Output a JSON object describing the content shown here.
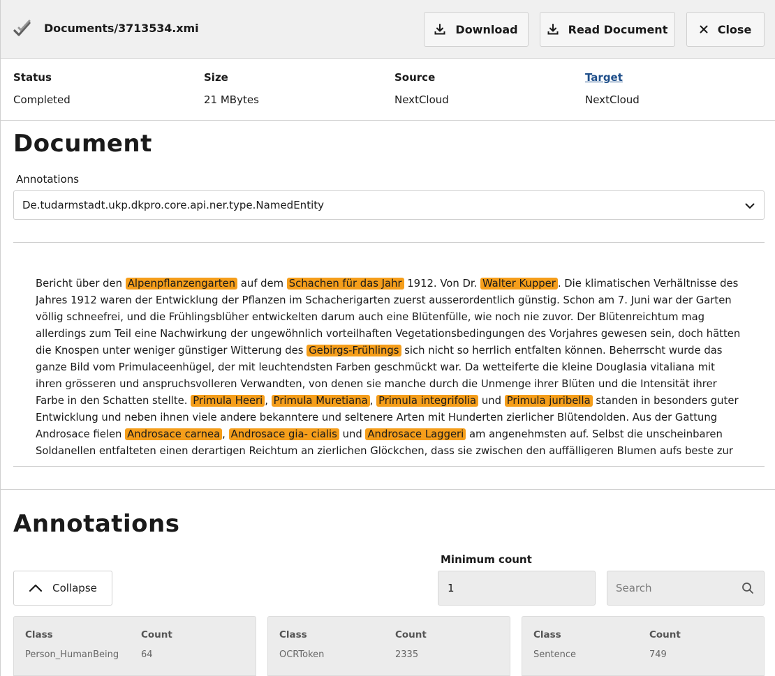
{
  "header": {
    "title": "Documents/3713534.xmi",
    "download_label": "Download",
    "read_label": "Read Document",
    "close_label": "Close"
  },
  "info": {
    "status": {
      "label": "Status",
      "value": "Completed"
    },
    "size": {
      "label": "Size",
      "value": "21 MBytes"
    },
    "source": {
      "label": "Source",
      "value": "NextCloud"
    },
    "target": {
      "label": "Target",
      "value": "NextCloud"
    }
  },
  "document": {
    "heading": "Document",
    "annotations_label": "Annotations",
    "annotation_type": "De.tudarmstadt.ukp.dkpro.core.api.ner.type.NamedEntity",
    "text_segments": [
      {
        "t": "Bericht über den "
      },
      {
        "t": "Alpenpflanzengarten",
        "e": true
      },
      {
        "t": " auf dem "
      },
      {
        "t": "Schachen für das Jahr",
        "e": true
      },
      {
        "t": " 1912. Von Dr. "
      },
      {
        "t": "Walter Kupper",
        "e": true
      },
      {
        "t": ". Die klimatischen Verhältnisse des Jahres 1912 waren der Entwicklung der Pflanzen im Schacherigarten zuerst ausserordentlich günstig. Schon am 7. Juni war der Garten völlig schneefrei, und die Frühlingsblüher entwickelten darum auch eine Blütenfülle, wie noch nie zuvor. Der Blütenreichtum mag allerdings zum Teil eine Nachwirkung der ungewöhnlich vorteilhaften Vegetationsbedingungen des Vorjahres gewesen sein, doch hätten die Knospen unter weniger günstiger Witterung des "
      },
      {
        "t": "Gebirgs-Frühlings",
        "e": true
      },
      {
        "t": " sich nicht so herrlich entfalten können. Beherrscht wurde das ganze Bild vom Primulaceenhügel, der mit leuchtendsten Farben geschmückt war. Da wetteiferte die kleine Douglasia vitaliana mit ihren grösseren und anspruchsvolleren Verwandten, von denen sie manche durch die Unmenge ihrer Blüten und die Intensität ihrer Farbe in den Schatten stellte. "
      },
      {
        "t": "Primula Heeri",
        "e": true
      },
      {
        "t": ", "
      },
      {
        "t": "Primula Muretiana",
        "e": true
      },
      {
        "t": ", "
      },
      {
        "t": "Primula integrifolia",
        "e": true
      },
      {
        "t": " und "
      },
      {
        "t": "Primula juribella",
        "e": true
      },
      {
        "t": " standen in besonders guter Entwicklung und neben ihnen viele andere bekanntere und seltenere Arten mit Hunderten zierlicher Blütendolden. Aus der Gattung Androsace fielen "
      },
      {
        "t": "Androsace carnea",
        "e": true
      },
      {
        "t": ", "
      },
      {
        "t": "Androsace gia- cialis",
        "e": true
      },
      {
        "t": " und "
      },
      {
        "t": "Androsace Laggeri",
        "e": true
      },
      {
        "t": " am angenehmsten auf. Selbst die unscheinbaren Soldanellen entfalteten einen derartigen Reichtum an zierlichen Glöckchen, dass sie zwischen den auffälligeren Blumen aufs beste zur"
      }
    ]
  },
  "annotations": {
    "heading": "Annotations",
    "collapse_label": "Collapse",
    "min_count_label": "Minimum count",
    "min_count_value": "1",
    "search_placeholder": "Search",
    "class_header": "Class",
    "count_header": "Count",
    "cards": [
      {
        "class": "Person_HumanBeing",
        "count": "64"
      },
      {
        "class": "OCRToken",
        "count": "2335"
      },
      {
        "class": "Sentence",
        "count": "749"
      }
    ]
  },
  "colors": {
    "entity_highlight": "#f59e1b",
    "header_bg": "#f0f0f0",
    "link": "#1f4f8a"
  }
}
